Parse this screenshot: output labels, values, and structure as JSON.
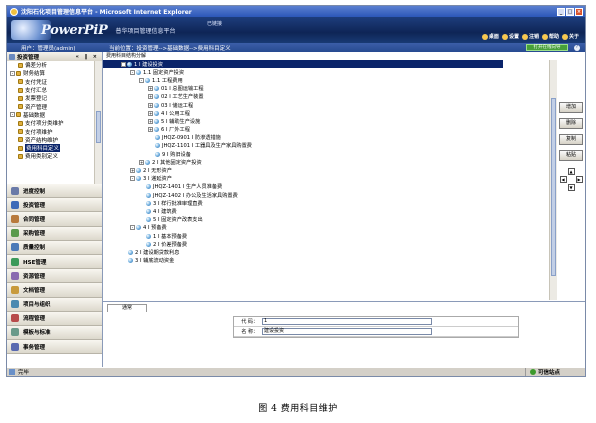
{
  "window": {
    "title": "沈阳石化项目管理信息平台 - Microsoft Internet Explorer",
    "buttons": [
      "_",
      "□",
      "×"
    ]
  },
  "banner": {
    "logo": "PowerPiP",
    "subtitle": "普华项目管理信息平台",
    "system_label": "已链接",
    "tools": [
      "桌面",
      "设置",
      "注销",
      "帮助",
      "关于"
    ]
  },
  "infobar": {
    "user": "用户：管理员(admin)",
    "breadcrumb": "当前位置：投资管理-->基础数据-->费用科目定义",
    "gear_label": "打开在线向导",
    "help": "?"
  },
  "left_panel": {
    "header": "投资管理",
    "controls": "« ‖ ×",
    "tree": [
      {
        "label": "偏差分析",
        "depth": 2,
        "toggle": ""
      },
      {
        "label": "财务结算",
        "depth": 0,
        "toggle": "-"
      },
      {
        "label": "支付凭证",
        "depth": 2,
        "toggle": ""
      },
      {
        "label": "支付汇总",
        "depth": 2,
        "toggle": ""
      },
      {
        "label": "发票登记",
        "depth": 2,
        "toggle": ""
      },
      {
        "label": "资产管理",
        "depth": 2,
        "toggle": ""
      },
      {
        "label": "基础数据",
        "depth": 0,
        "toggle": "-"
      },
      {
        "label": "支付项分类维护",
        "depth": 2,
        "toggle": ""
      },
      {
        "label": "支付项维护",
        "depth": 2,
        "toggle": ""
      },
      {
        "label": "资产结构维护",
        "depth": 2,
        "toggle": ""
      },
      {
        "label": "费用科目定义",
        "depth": 2,
        "toggle": "",
        "selected": true
      },
      {
        "label": "费用类别定义",
        "depth": 2,
        "toggle": ""
      }
    ],
    "modules": [
      {
        "label": "进度控制",
        "color": "#6a7aa8"
      },
      {
        "label": "投资管理",
        "color": "#3c6ab8"
      },
      {
        "label": "合同管理",
        "color": "#b87a3c"
      },
      {
        "label": "采购管理",
        "color": "#5a9a4c"
      },
      {
        "label": "质量控制",
        "color": "#4c7ab8"
      },
      {
        "label": "HSE管理",
        "color": "#3c9a5a"
      },
      {
        "label": "资源管理",
        "color": "#8a6ab0"
      },
      {
        "label": "文档管理",
        "color": "#c89a3c"
      },
      {
        "label": "项目与组织",
        "color": "#4c8ab0"
      },
      {
        "label": "流程管理",
        "color": "#b84c4c"
      },
      {
        "label": "模板与标准",
        "color": "#6a9a8a"
      },
      {
        "label": "事务管理",
        "color": "#5a6ab0"
      }
    ]
  },
  "center": {
    "tab": "费用科目结构分解",
    "tree": [
      {
        "label": "1 I 建设投资",
        "depth": 0,
        "toggle": "-",
        "selected": true
      },
      {
        "label": "1.1 固定资产投资",
        "depth": 1,
        "toggle": "-"
      },
      {
        "label": "1.1 工程费用",
        "depth": 2,
        "toggle": "-"
      },
      {
        "label": "01 I 总图运输工程",
        "depth": 3,
        "toggle": "+"
      },
      {
        "label": "02 I 工艺生产装置",
        "depth": 3,
        "toggle": "+"
      },
      {
        "label": "03 I 储运工程",
        "depth": 3,
        "toggle": "+"
      },
      {
        "label": "4 I 公用工程",
        "depth": 3,
        "toggle": "+"
      },
      {
        "label": "5 I 辅助生产设施",
        "depth": 3,
        "toggle": "+"
      },
      {
        "label": "6 I 厂外工程",
        "depth": 3,
        "toggle": "+"
      },
      {
        "label": "JHQZ-0901 I 防渗透措施",
        "depth": 3,
        "toggle": ""
      },
      {
        "label": "JHQZ-1101 I 工器具及生产家具购置费",
        "depth": 3,
        "toggle": ""
      },
      {
        "label": "9 I 购旧设备",
        "depth": 3,
        "toggle": ""
      },
      {
        "label": "2 I 其他固定资产投资",
        "depth": 2,
        "toggle": "+"
      },
      {
        "label": "2 I 无形资产",
        "depth": 1,
        "toggle": "+"
      },
      {
        "label": "3 I 递延资产",
        "depth": 1,
        "toggle": "-"
      },
      {
        "label": "JHQZ-1401 I 生产人员准备费",
        "depth": 2,
        "toggle": ""
      },
      {
        "label": "JHQZ-1402 I 办公及生活家具购置费",
        "depth": 2,
        "toggle": ""
      },
      {
        "label": "3 I 样行批准审理直费",
        "depth": 2,
        "toggle": ""
      },
      {
        "label": "4 I 建筑费",
        "depth": 2,
        "toggle": ""
      },
      {
        "label": "5 I 固定资产改表支出",
        "depth": 2,
        "toggle": ""
      },
      {
        "label": "4 I 预备费",
        "depth": 1,
        "toggle": "-"
      },
      {
        "label": "1 I 基本预备费",
        "depth": 2,
        "toggle": ""
      },
      {
        "label": "2 I 价差预备费",
        "depth": 2,
        "toggle": ""
      },
      {
        "label": "2 I 建设期贷款利息",
        "depth": 0,
        "toggle": ""
      },
      {
        "label": "3 I 辅底流动资金",
        "depth": 0,
        "toggle": ""
      }
    ],
    "buttons": [
      "增加",
      "删除",
      "复制",
      "粘贴"
    ],
    "arrows": {
      "up": "▲",
      "down": "▼",
      "left": "◀",
      "right": "▶"
    }
  },
  "detail": {
    "tab": "通常",
    "fields": [
      {
        "label": "代 码：",
        "value": "1"
      },
      {
        "label": "名 称：",
        "value": "建设投资"
      }
    ]
  },
  "statusbar": {
    "left": "完毕",
    "zone": "可信站点"
  },
  "caption": "图 4  费用科目维护"
}
